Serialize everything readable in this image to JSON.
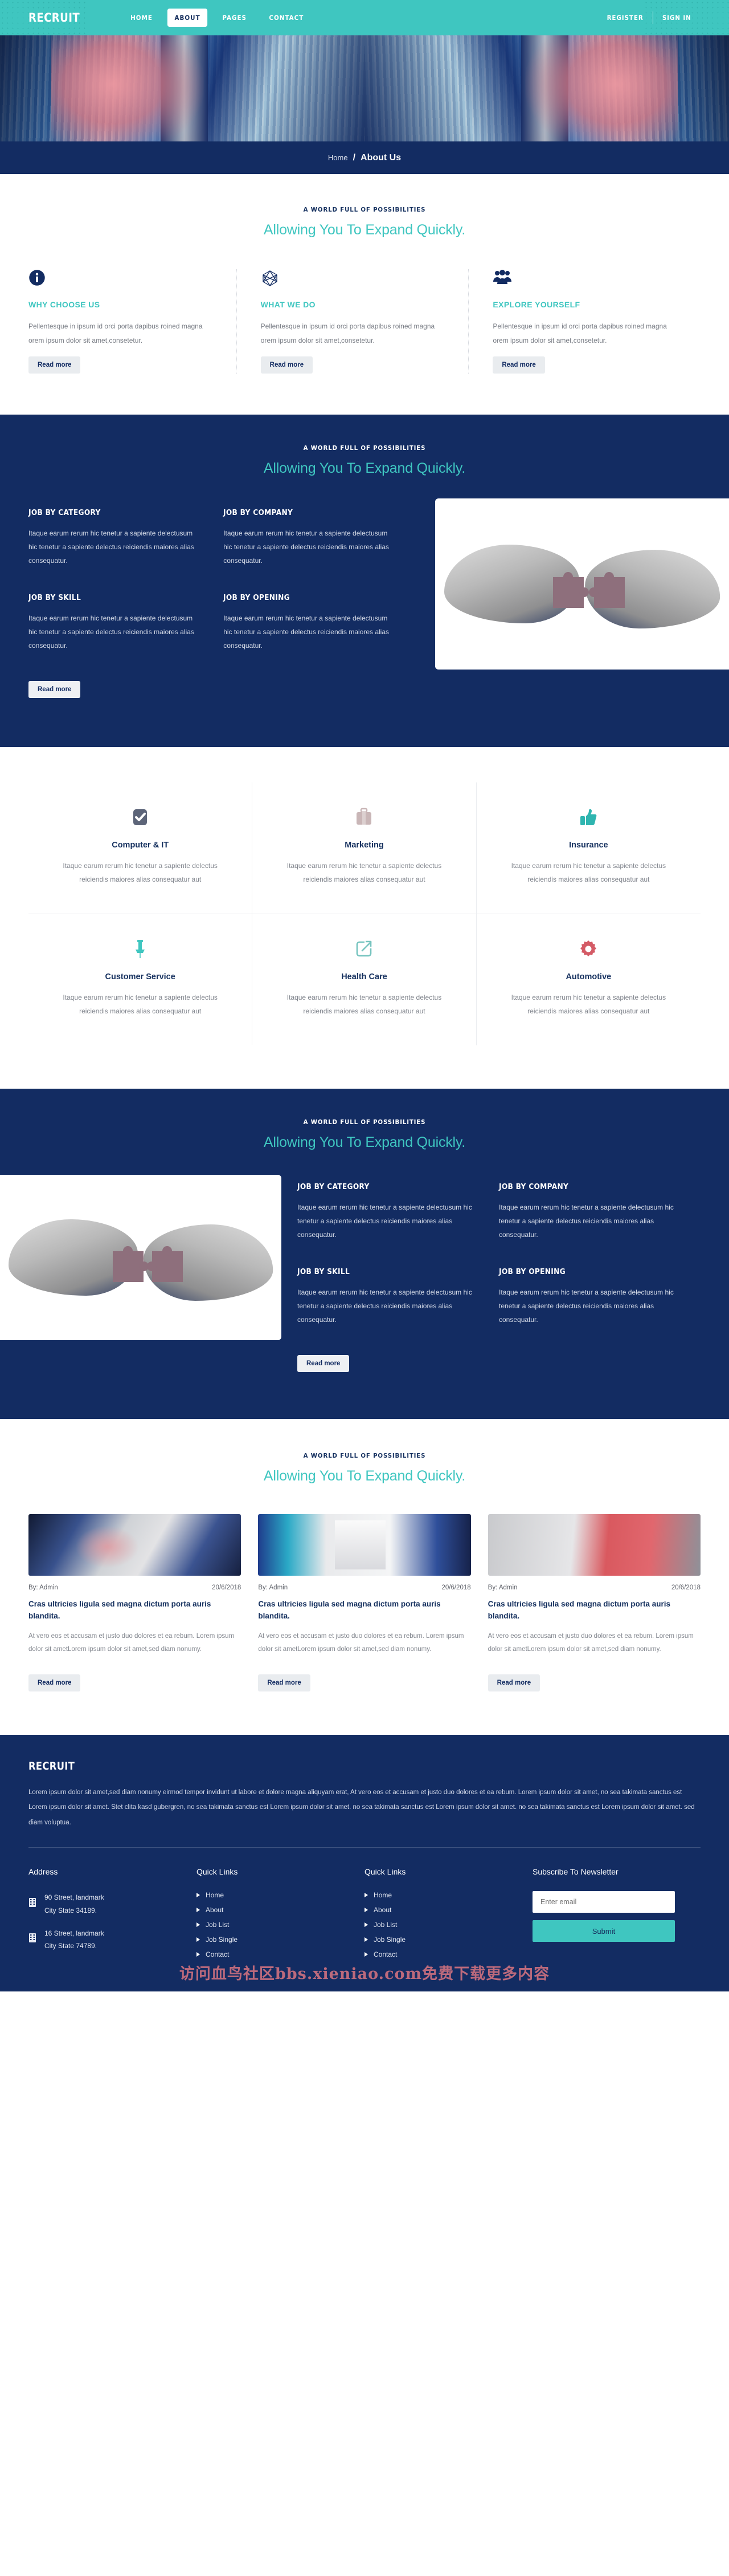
{
  "header": {
    "brand": "RECRUIT",
    "nav": [
      {
        "label": "HOME",
        "active": false
      },
      {
        "label": "ABOUT",
        "active": true
      },
      {
        "label": "PAGES",
        "active": false
      },
      {
        "label": "CONTACT",
        "active": false
      }
    ],
    "register_label": "REGISTER",
    "signin_label": "SIGN IN",
    "accent_color": "#3fc6c0",
    "navy_color": "#132c62"
  },
  "breadcrumb": {
    "home": "Home",
    "separator": "/",
    "current": "About Us"
  },
  "section_heading": {
    "eyebrow": "A WORLD FULL OF POSSIBILITIES",
    "title": "Allowing You To Expand Quickly."
  },
  "features": {
    "read_more": "Read more",
    "items": [
      {
        "icon": "info-circle-icon",
        "title": "WHY CHOOSE US",
        "text": "Pellentesque in ipsum id orci porta dapibus roined magna orem ipsum dolor sit amet,consetetur.",
        "button": "Read more"
      },
      {
        "icon": "hexagon-network-icon",
        "title": "WHAT WE DO",
        "text": "Pellentesque in ipsum id orci porta dapibus roined magna orem ipsum dolor sit amet,consetetur.",
        "button": "Read more"
      },
      {
        "icon": "users-group-icon",
        "title": "EXPLORE YOURSELF",
        "text": "Pellentesque in ipsum id orci porta dapibus roined magna orem ipsum dolor sit amet,consetetur.",
        "button": "Read more"
      }
    ]
  },
  "jobs_section_a": {
    "eyebrow": "A WORLD FULL OF POSSIBILITIES",
    "title": "Allowing You To Expand Quickly.",
    "read_more": "Read more",
    "items": [
      {
        "title": "JOB BY CATEGORY",
        "text": "Itaque earum rerum hic tenetur a sapiente delectusum hic tenetur a sapiente delectus reiciendis maiores alias consequatur."
      },
      {
        "title": "JOB BY COMPANY",
        "text": "Itaque earum rerum hic tenetur a sapiente delectusum hic tenetur a sapiente delectus reiciendis maiores alias consequatur."
      },
      {
        "title": "JOB BY SKILL",
        "text": "Itaque earum rerum hic tenetur a sapiente delectusum hic tenetur a sapiente delectus reiciendis maiores alias consequatur."
      },
      {
        "title": "JOB BY OPENING",
        "text": "Itaque earum rerum hic tenetur a sapiente delectusum hic tenetur a sapiente delectus reiciendis maiores alias consequatur."
      }
    ]
  },
  "categories": {
    "items": [
      {
        "icon": "check-square-icon",
        "icon_color": "#5d6579",
        "title": "Computer & IT",
        "text": "Itaque earum rerum hic tenetur a sapiente delectus reiciendis maiores alias consequatur aut"
      },
      {
        "icon": "briefcase-icon",
        "icon_color": "#c9b6b7",
        "title": "Marketing",
        "text": "Itaque earum rerum hic tenetur a sapiente delectus reiciendis maiores alias consequatur aut"
      },
      {
        "icon": "thumbs-up-icon",
        "icon_color": "#2fb5b0",
        "title": "Insurance",
        "text": "Itaque earum rerum hic tenetur a sapiente delectus reiciendis maiores alias consequatur aut"
      },
      {
        "icon": "push-pin-icon",
        "icon_color": "#3fc6c0",
        "title": "Customer Service",
        "text": "Itaque earum rerum hic tenetur a sapiente delectus reiciendis maiores alias consequatur aut"
      },
      {
        "icon": "external-link-icon",
        "icon_color": "#76c4bf",
        "title": "Health Care",
        "text": "Itaque earum rerum hic tenetur a sapiente delectus reiciendis maiores alias consequatur aut"
      },
      {
        "icon": "gear-icon",
        "icon_color": "#d45b66",
        "title": "Automotive",
        "text": "Itaque earum rerum hic tenetur a sapiente delectus reiciendis maiores alias consequatur aut"
      }
    ]
  },
  "jobs_section_b": {
    "eyebrow": "A WORLD FULL OF POSSIBILITIES",
    "title": "Allowing You To Expand Quickly.",
    "read_more": "Read more",
    "items": [
      {
        "title": "JOB BY CATEGORY",
        "text": "Itaque earum rerum hic tenetur a sapiente delectusum hic tenetur a sapiente delectus reiciendis maiores alias consequatur."
      },
      {
        "title": "JOB BY COMPANY",
        "text": "Itaque earum rerum hic tenetur a sapiente delectusum hic tenetur a sapiente delectus reiciendis maiores alias consequatur."
      },
      {
        "title": "JOB BY SKILL",
        "text": "Itaque earum rerum hic tenetur a sapiente delectusum hic tenetur a sapiente delectus reiciendis maiores alias consequatur."
      },
      {
        "title": "JOB BY OPENING",
        "text": "Itaque earum rerum hic tenetur a sapiente delectusum hic tenetur a sapiente delectus reiciendis maiores alias consequatur."
      }
    ]
  },
  "blog": {
    "eyebrow": "A WORLD FULL OF POSSIBILITIES",
    "title": "Allowing You To Expand Quickly.",
    "posts": [
      {
        "author": "By: Admin",
        "date": "20/6/2018",
        "title": "Cras ultricies ligula sed magna dictum porta auris blandita.",
        "excerpt": "At vero eos et accusam et justo duo dolores et ea rebum. Lorem ipsum dolor sit ametLorem ipsum dolor sit amet,sed diam nonumy.",
        "button": "Read more"
      },
      {
        "author": "By: Admin",
        "date": "20/6/2018",
        "title": "Cras ultricies ligula sed magna dictum porta auris blandita.",
        "excerpt": "At vero eos et accusam et justo duo dolores et ea rebum. Lorem ipsum dolor sit ametLorem ipsum dolor sit amet,sed diam nonumy.",
        "button": "Read more"
      },
      {
        "author": "By: Admin",
        "date": "20/6/2018",
        "title": "Cras ultricies ligula sed magna dictum porta auris blandita.",
        "excerpt": "At vero eos et accusam et justo duo dolores et ea rebum. Lorem ipsum dolor sit ametLorem ipsum dolor sit amet,sed diam nonumy.",
        "button": "Read more"
      }
    ]
  },
  "footer": {
    "brand": "RECRUIT",
    "about": "Lorem ipsum dolor sit amet,sed diam nonumy eirmod tempor invidunt ut labore et dolore magna aliquyam erat, At vero eos et accusam et justo duo dolores et ea rebum. Lorem ipsum dolor sit amet, no sea takimata sanctus est Lorem ipsum dolor sit amet. Stet clita kasd gubergren, no sea takimata sanctus est Lorem ipsum dolor sit amet. no sea takimata sanctus est Lorem ipsum dolor sit amet. no sea takimata sanctus est Lorem ipsum dolor sit amet. sed diam voluptua.",
    "address": {
      "heading": "Address",
      "entries": [
        {
          "line1": "90 Street, landmark",
          "line2": "City State 34189."
        },
        {
          "line1": "16 Street, landmark",
          "line2": "City State 74789."
        }
      ]
    },
    "quick_links_1": {
      "heading": "Quick Links",
      "items": [
        "Home",
        "About",
        "Job List",
        "Job Single",
        "Contact"
      ]
    },
    "quick_links_2": {
      "heading": "Quick Links",
      "items": [
        "Home",
        "About",
        "Job List",
        "Job Single",
        "Contact"
      ]
    },
    "newsletter": {
      "heading": "Subscribe To Newsletter",
      "placeholder": "Enter email",
      "value": "",
      "submit": "Submit"
    },
    "watermark": "访问血鸟社区bbs.xieniao.com免费下载更多内容"
  }
}
